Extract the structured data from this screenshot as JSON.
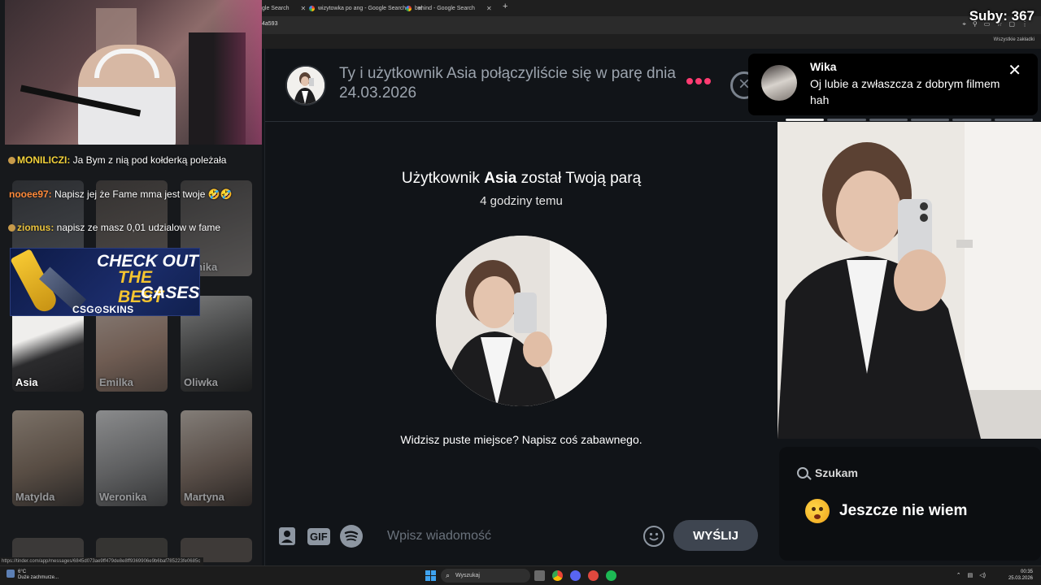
{
  "overlay": {
    "subs": "Suby: 367"
  },
  "browser": {
    "tabs": [
      {
        "label": "gle Search"
      },
      {
        "label": "wizytowka po ang - Google Search"
      },
      {
        "label": "behind - Google Search"
      }
    ],
    "address_fragment": "4a593",
    "bookmarks_label": "Wszystkie zakładki"
  },
  "stream_chat": [
    {
      "user": "MONILICZI:",
      "text": " Ja Bym z nią pod kołderką poleżała"
    },
    {
      "user": "nooee97:",
      "text": " Napisz jej że Fame mma jest twoje 🤣🤣"
    },
    {
      "user": "ziomus:",
      "text": " napisz ze masz 0,01 udzialow w fame"
    }
  ],
  "ad": {
    "line1": "CHECK OUT",
    "line2": "THE BEST",
    "line3": "CASES",
    "brand": "CSG⊙SKINS"
  },
  "match_tiles": [
    {
      "name": "minika"
    },
    {
      "name": "Asia"
    },
    {
      "name": "Emilka"
    },
    {
      "name": "Oliwka"
    },
    {
      "name": "Matylda"
    },
    {
      "name": "Weronika"
    },
    {
      "name": "Martyna"
    }
  ],
  "chat_header": {
    "match_text": "Ty i użytkownik Asia połączyliście się w parę dnia 24.03.2026"
  },
  "match_info": {
    "title_prefix": "Użytkownik ",
    "title_name": "Asia",
    "title_suffix": " został Twoją parą",
    "time_ago": "4 godziny temu",
    "prompt": "Widzisz puste miejsce? Napisz coś zabawnego."
  },
  "composer": {
    "gif_label": "GIF",
    "placeholder": "Wpisz wiadomość",
    "send_label": "WYŚLIJ"
  },
  "notification": {
    "name": "Wika",
    "message": "Oj lubie a zwłaszcza z dobrym filmem hah"
  },
  "profile": {
    "photo_count": 6,
    "current_photo": 1,
    "looking_for_label": "Szukam",
    "looking_for_value": "Jeszcze nie wiem"
  },
  "statusbar": {
    "url": "https://tinder.com/app/messages/6845d073ae9ff479de8e8ff9369906e9b6baf785223fe0685c"
  },
  "taskbar": {
    "weather_temp": "6°C",
    "weather_desc": "Duże zachmurze...",
    "search_label": "Wyszukaj",
    "time": "00:35",
    "date": "25.03.2026"
  },
  "colors": {
    "tinder_pink": "#fe3c72",
    "panel_bg": "#111418",
    "send_btn": "#3e4550"
  }
}
